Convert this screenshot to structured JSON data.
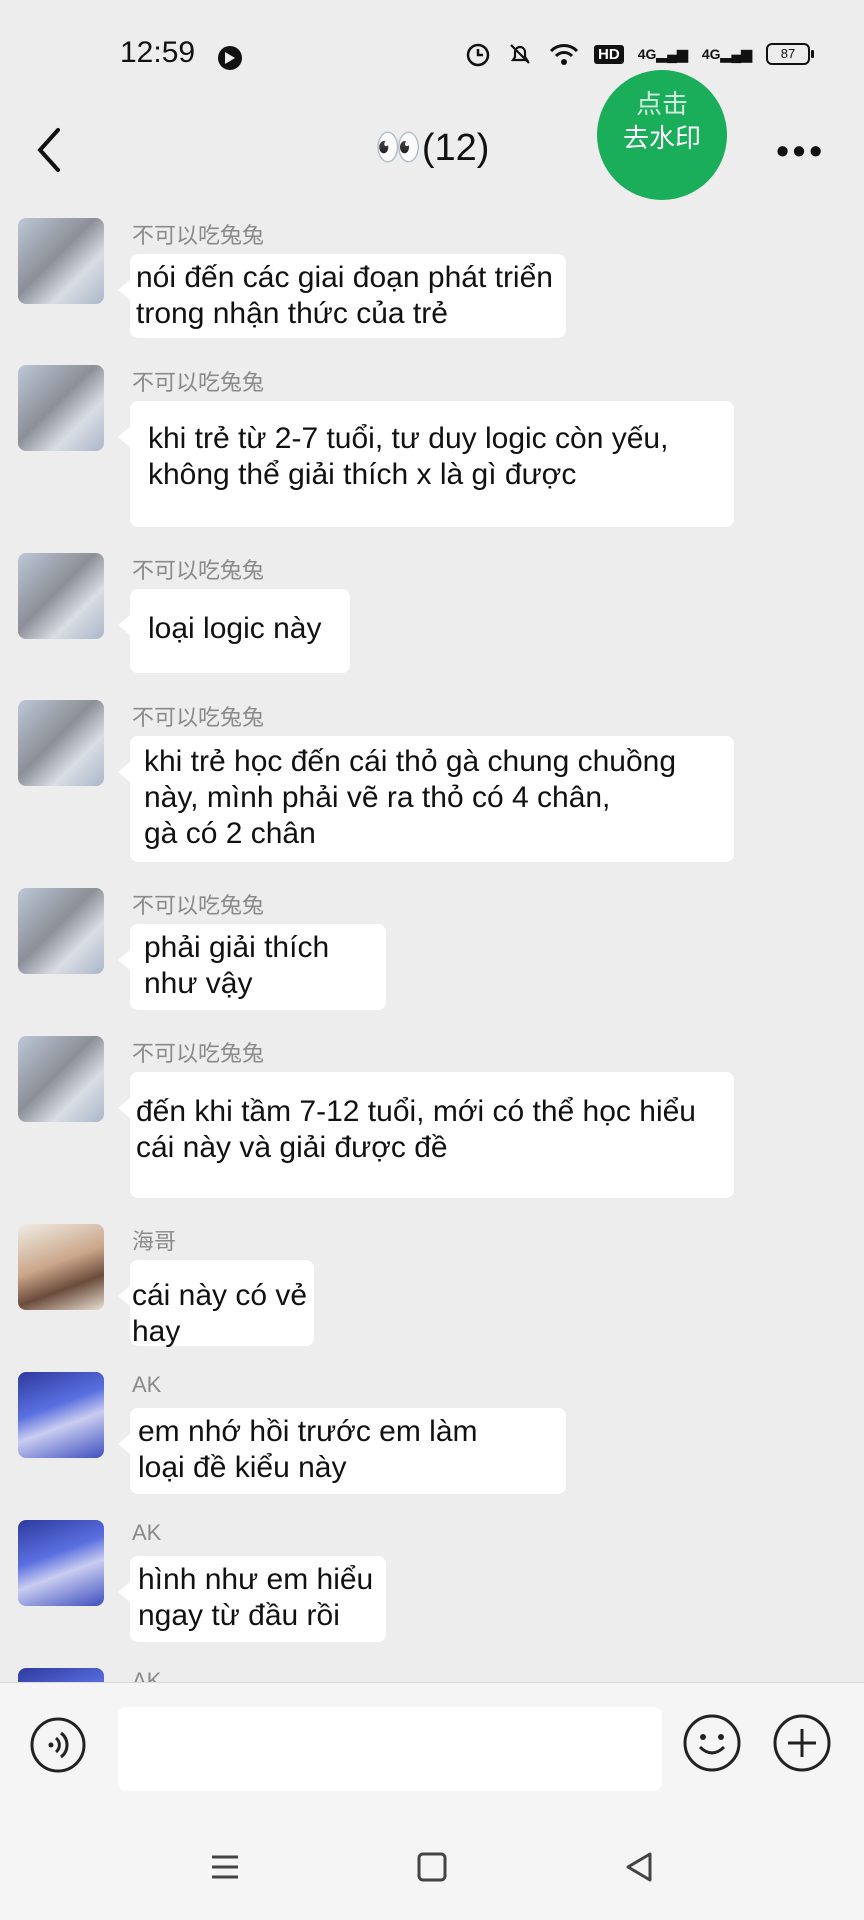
{
  "status_bar": {
    "time": "12:59",
    "signal1": "4G",
    "signal2": "4G",
    "hd": "HD",
    "battery": "87"
  },
  "header": {
    "title": "👀(12)",
    "watermark_line1": "点击",
    "watermark_line2": "去水印"
  },
  "messages": [
    {
      "sender": "不可以吃兔兔",
      "text": "nói đến các giai đoạn phát triển\ntrong nhận thức của trẻ"
    },
    {
      "sender": "不可以吃兔兔",
      "text": "khi trẻ từ 2-7 tuổi, tư duy logic còn yếu,\nkhông thể giải thích x là gì được"
    },
    {
      "sender": "不可以吃兔兔",
      "text": "loại logic này"
    },
    {
      "sender": "不可以吃兔兔",
      "text": "khi trẻ học đến cái thỏ gà chung chuồng\nnày, mình phải vẽ ra thỏ có 4 chân,\ngà có 2 chân"
    },
    {
      "sender": "不可以吃兔兔",
      "text": "phải giải thích\nnhư vậy"
    },
    {
      "sender": "不可以吃兔兔",
      "text": "đến khi tầm 7-12 tuổi, mới có thể học hiểu\ncái này và giải được đề"
    },
    {
      "sender": "海哥",
      "text": "cái này có vẻ hay"
    },
    {
      "sender": "AK",
      "text": "em nhớ hồi trước em làm\nloại đề kiểu này"
    },
    {
      "sender": "AK",
      "text": "hình như em hiểu\nngay từ đầu rồi"
    },
    {
      "sender": "AK",
      "text": ""
    }
  ],
  "input": {
    "placeholder": ""
  }
}
